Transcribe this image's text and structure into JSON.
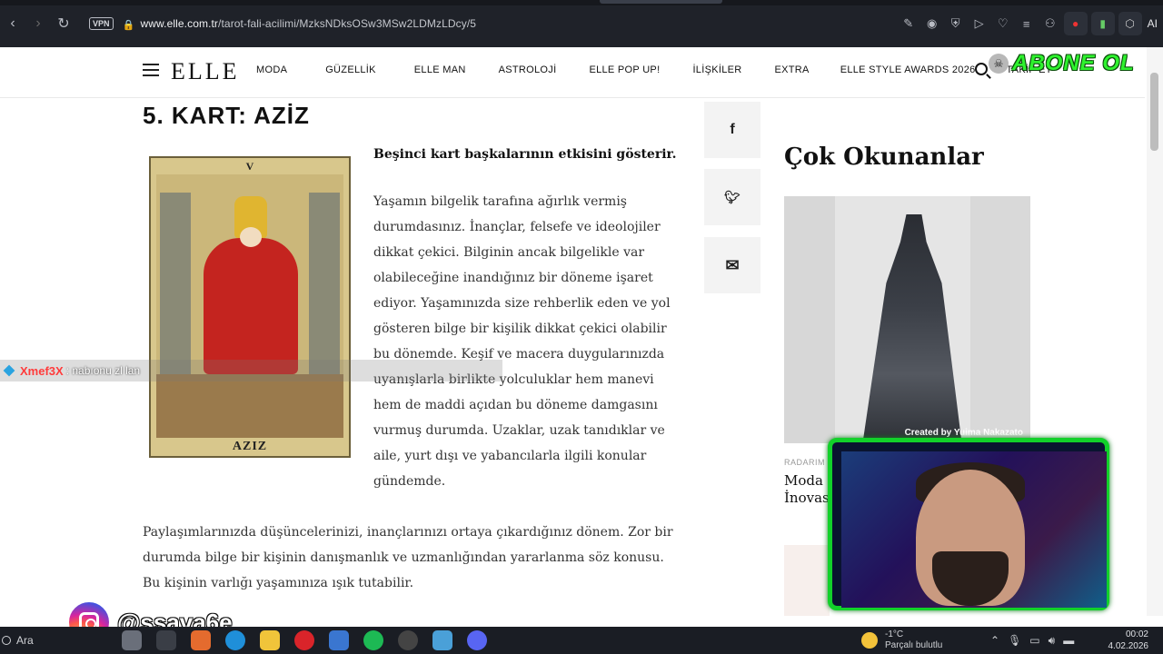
{
  "browser": {
    "url_host": "www.elle.com.tr",
    "url_path": "/tarot-fali-acilimi/MzksNDksOSw3MSw2LDMzLDcy/5",
    "vpn_label": "VPN",
    "ai_label": "AI"
  },
  "site": {
    "logo": "ELLE",
    "menu": [
      "MODA",
      "GÜZELLİK",
      "ELLE MAN",
      "ASTROLOJİ",
      "ELLE POP UP!",
      "İLİŞKİLER",
      "EXTRA",
      "ELLE STYLE AWARDS 2026",
      "TAKİP ET"
    ],
    "overlay_subscribe": "ABONE OL"
  },
  "article": {
    "title": "5. KART: AZİZ",
    "card_numeral": "V",
    "card_name": "AZIZ",
    "lead": "Beşinci kart başkalarının etkisini gösterir.",
    "paragraph1_lines": [
      "Yaşamın bilgelik tarafına ağırlık vermiş",
      "durumdasınız. İnançlar, felsefe ve ideolojiler",
      "dikkat çekici. Bilginin ancak bilgelikle var",
      "olabileceğine inandığınız bir döneme işaret",
      "ediyor. Yaşamınızda size rehberlik eden ve yol",
      "gösteren bilge bir kişilik dikkat çekici olabilir",
      "bu dönemde. Keşif ve macera duygularınızda",
      "uyanışlarla birlikte yolculuklar hem manevi",
      "hem de maddi açıdan bu döneme damgasını",
      "vurmuş durumda. Uzaklar, uzak tanıdıklar ve",
      "aile, yurt dışı ve yabancılarla ilgili konular",
      "gündemde."
    ],
    "paragraph2_lines": [
      "Paylaşımlarınızda düşüncelerinizi, inançlarınızı ortaya çıkardığınız dönem. Zor bir",
      "durumda bilge bir kişinin danışmanlık ve uzmanlığından yararlanma söz konusu.",
      "Bu kişinin varlığı yaşamınıza ışık tutabilir."
    ]
  },
  "share": {
    "facebook": "f",
    "twitter": "🐦",
    "email": "✉"
  },
  "sidebar": {
    "heading": "Çok Okunanlar",
    "image_credit": "Created by Yuima Nakazato",
    "category": "RADARIM",
    "article_title_lines": [
      "Moda",
      "İnovas"
    ]
  },
  "overlays": {
    "chat_user": "Xmef3X",
    "chat_message": ": nabıonu zl lan",
    "instagram_handle": "@ssava6e"
  },
  "taskbar": {
    "search": "Ara",
    "weather_temp": "-1°C",
    "weather_desc": "Parçalı bulutlu",
    "time": "00:02",
    "date": "4.02.2026"
  }
}
